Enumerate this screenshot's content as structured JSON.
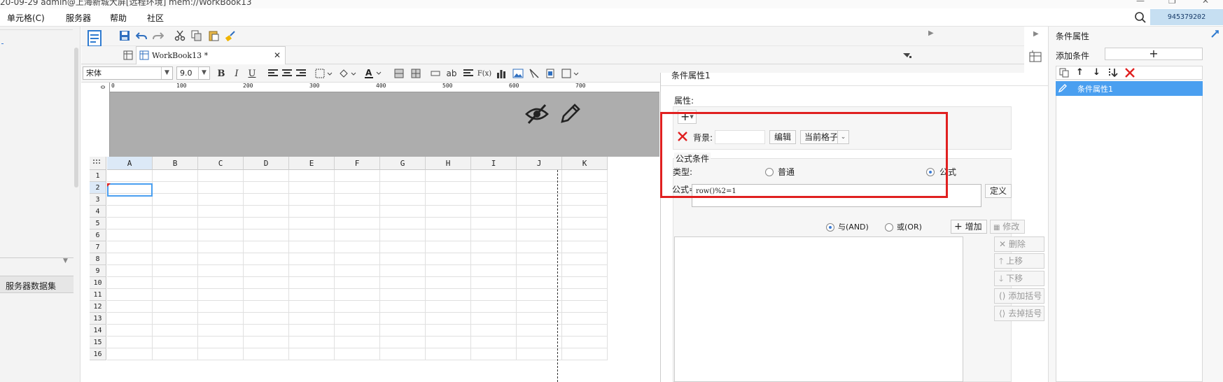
{
  "titlebar": {
    "text": "20-09-29 admin@上海新城大屏[远程环境]    mem://WorkBook13",
    "minimize": "—",
    "restore": "❐",
    "close": "✕"
  },
  "menu": [
    "单元格(C)",
    "服务器",
    "帮助",
    "社区"
  ],
  "user_id": "945379202",
  "left_panel": {
    "section_title": "服务器数据集"
  },
  "tab": {
    "label": "WorkBook13 *",
    "close": "✕"
  },
  "font": {
    "name": "宋体",
    "size": "9.0"
  },
  "format_buttons": {
    "bold": "B",
    "italic": "I",
    "underline": "U",
    "ab": "ab",
    "fx": "F(x)"
  },
  "ruler_marks": [
    "0",
    "100",
    "200",
    "300",
    "400",
    "500",
    "600",
    "700"
  ],
  "ruler_vertical": "0",
  "columns": [
    "A",
    "B",
    "C",
    "D",
    "E",
    "F",
    "G",
    "H",
    "I",
    "J",
    "K"
  ],
  "rows": [
    "1",
    "2",
    "3",
    "4",
    "5",
    "6",
    "7",
    "8",
    "9",
    "10",
    "11",
    "12",
    "13",
    "14",
    "15",
    "16"
  ],
  "dialog": {
    "title": "条件属性1",
    "attr_label": "属性:",
    "add_symbol": "+",
    "bg_label": "背景:",
    "edit_button": "编辑",
    "scope_value": "当前格子",
    "formula_section": "公式条件",
    "type_label": "类型:",
    "type_normal": "普通",
    "type_formula": "公式",
    "formula_label": "公式=",
    "formula_value": "row()%2=1",
    "define_button": "定义",
    "and_label": "与(AND)",
    "or_label": "或(OR)",
    "add_button": "增加",
    "modify_button": "修改",
    "delete_button": "删除",
    "move_up_button": "上移",
    "move_down_button": "下移",
    "add_bracket_button": "添加括号",
    "remove_bracket_button": "去掉括号"
  },
  "right_panel": {
    "title": "条件属性",
    "add_condition_label": "添加条件",
    "add_symbol": "+",
    "list_item": "条件属性1"
  },
  "colors": {
    "highlight_border": "#e02020",
    "selection_blue": "#4a9ff0",
    "header_gray": "#adadad",
    "user_bg": "#c6dff2"
  }
}
